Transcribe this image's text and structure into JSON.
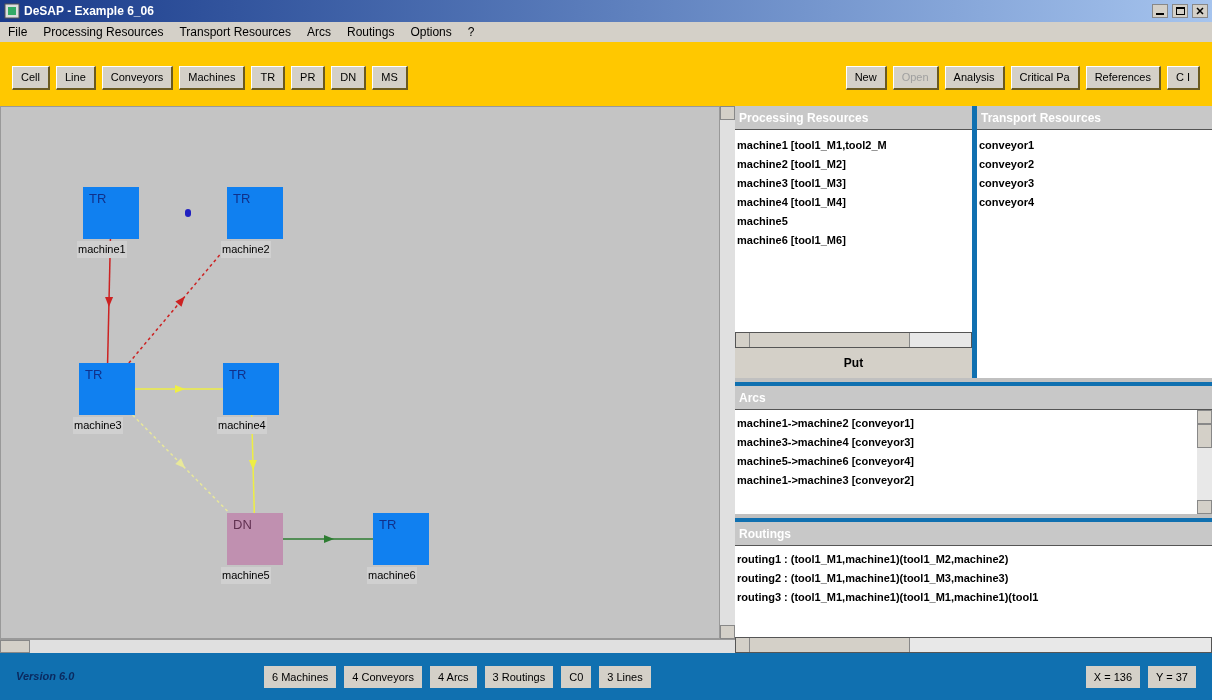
{
  "window": {
    "title": "DeSAP - Example 6_06"
  },
  "menu": [
    "File",
    "Processing Resources",
    "Transport Resources",
    "Arcs",
    "Routings",
    "Options",
    "?"
  ],
  "toolbar_left": [
    {
      "label": "Cell",
      "disabled": false
    },
    {
      "label": "Line",
      "disabled": false
    },
    {
      "label": "Conveyors",
      "disabled": false
    },
    {
      "label": "Machines",
      "disabled": false
    },
    {
      "label": "TR",
      "disabled": false
    },
    {
      "label": "PR",
      "disabled": false
    },
    {
      "label": "DN",
      "disabled": false
    },
    {
      "label": "MS",
      "disabled": false
    }
  ],
  "toolbar_right": [
    {
      "label": "New",
      "disabled": false
    },
    {
      "label": "Open",
      "disabled": true
    },
    {
      "label": "Analysis",
      "disabled": false
    },
    {
      "label": "Critical Pa",
      "disabled": false
    },
    {
      "label": "References",
      "disabled": false
    },
    {
      "label": "C I",
      "disabled": false
    }
  ],
  "diagram": {
    "nodes": [
      {
        "kind": "TR",
        "name": "machine1"
      },
      {
        "kind": "TR",
        "name": "machine2"
      },
      {
        "kind": "TR",
        "name": "machine3"
      },
      {
        "kind": "TR",
        "name": "machine4"
      },
      {
        "kind": "DN",
        "name": "machine5"
      },
      {
        "kind": "TR",
        "name": "machine6"
      }
    ],
    "edges": [
      {
        "color": "#cc2222",
        "kind": "solid"
      },
      {
        "color": "#cc2222",
        "kind": "dotted"
      },
      {
        "color": "#eeee44",
        "kind": "solid"
      },
      {
        "color": "#eeee44",
        "kind": "solid"
      },
      {
        "color": "#e8e89a",
        "kind": "dotted"
      },
      {
        "color": "#2e7d32",
        "kind": "solid"
      }
    ]
  },
  "processing_resources": {
    "title": "Processing Resources",
    "items": [
      "machine1 [tool1_M1,tool2_M",
      "machine2 [tool1_M2]",
      "machine3 [tool1_M3]",
      "machine4 [tool1_M4]",
      "machine5",
      "machine6 [tool1_M6]"
    ],
    "button": "Put"
  },
  "transport_resources": {
    "title": "Transport Resources",
    "items": [
      "conveyor1",
      "conveyor2",
      "conveyor3",
      "conveyor4"
    ]
  },
  "arcs": {
    "title": "Arcs",
    "items": [
      "machine1->machine2 [conveyor1]",
      "machine3->machine4 [conveyor3]",
      "machine5->machine6 [conveyor4]",
      "machine1->machine3 [conveyor2]"
    ]
  },
  "routings": {
    "title": "Routings",
    "items": [
      "routing1 : (tool1_M1,machine1)(tool1_M2,machine2)",
      "routing2 : (tool1_M1,machine1)(tool1_M3,machine3)",
      "routing3 : (tool1_M1,machine1)(tool1_M1,machine1)(tool1"
    ]
  },
  "status_bar": {
    "version": "Version 6.0",
    "fields": [
      "6 Machines",
      "4 Conveyors",
      "4 Arcs",
      "3 Routings",
      "C0",
      "3 Lines"
    ],
    "x": "X = 136",
    "y": "Y = 37"
  }
}
